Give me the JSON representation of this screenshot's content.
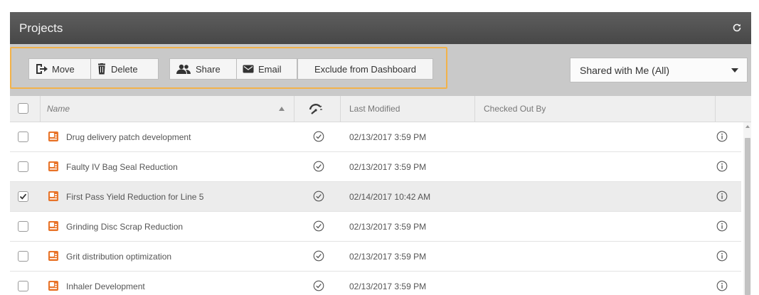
{
  "window": {
    "title": "Projects",
    "refresh_icon": "refresh-icon"
  },
  "toolbar": {
    "move_label": "Move",
    "delete_label": "Delete",
    "share_label": "Share",
    "email_label": "Email",
    "exclude_label": "Exclude from Dashboard",
    "filter": {
      "selected": "Shared with Me (All)"
    },
    "highlight_color": "#f2b24a"
  },
  "grid": {
    "columns": {
      "name": "Name",
      "status_icon": "gauge-icon",
      "last_modified": "Last Modified",
      "checked_out_by": "Checked Out By"
    },
    "rows": [
      {
        "name": "Drug delivery patch development",
        "last_modified": "02/13/2017 3:59 PM",
        "checked_out_by": "",
        "selected": false
      },
      {
        "name": "Faulty IV Bag Seal Reduction",
        "last_modified": "02/13/2017 3:59 PM",
        "checked_out_by": "",
        "selected": false
      },
      {
        "name": "First Pass Yield Reduction for Line 5",
        "last_modified": "02/14/2017 10:42 AM",
        "checked_out_by": "",
        "selected": true
      },
      {
        "name": "Grinding Disc Scrap Reduction",
        "last_modified": "02/13/2017 3:59 PM",
        "checked_out_by": "",
        "selected": false
      },
      {
        "name": "Grit distribution optimization",
        "last_modified": "02/13/2017 3:59 PM",
        "checked_out_by": "",
        "selected": false
      },
      {
        "name": "Inhaler Development",
        "last_modified": "02/13/2017 3:59 PM",
        "checked_out_by": "",
        "selected": false
      }
    ]
  },
  "colors": {
    "title_bar": "#4f4f4f",
    "toolbar": "#c9c9c9",
    "project_icon": "#e8742a"
  }
}
